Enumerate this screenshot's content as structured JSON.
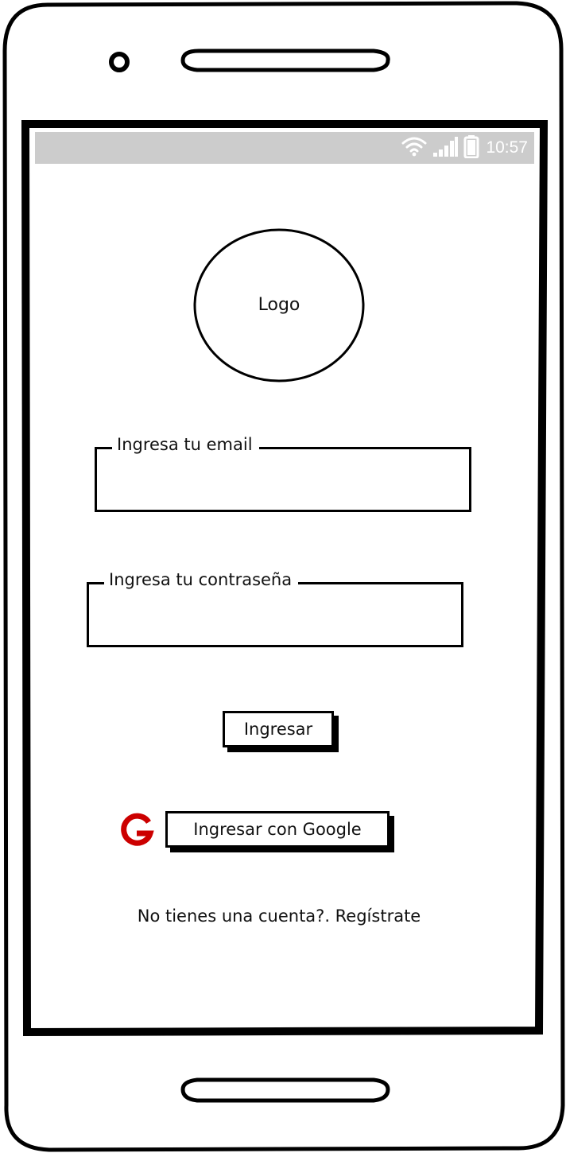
{
  "status_bar": {
    "time": "10:57",
    "icons": [
      "wifi-icon",
      "signal-icon",
      "battery-icon"
    ]
  },
  "logo": {
    "label": "Logo"
  },
  "email_field": {
    "label": "Ingresa tu email",
    "value": ""
  },
  "password_field": {
    "label": "Ingresa tu contraseña",
    "value": ""
  },
  "login_button": {
    "label": "Ingresar"
  },
  "google_login": {
    "icon": "google-icon",
    "label": "Ingresar con Google",
    "icon_color": "#cc0000"
  },
  "signup_link": {
    "text": "No tienes una cuenta?. Regístrate"
  },
  "colors": {
    "status_bar": "#cccccc",
    "frame": "#000000",
    "background": "#ffffff"
  }
}
